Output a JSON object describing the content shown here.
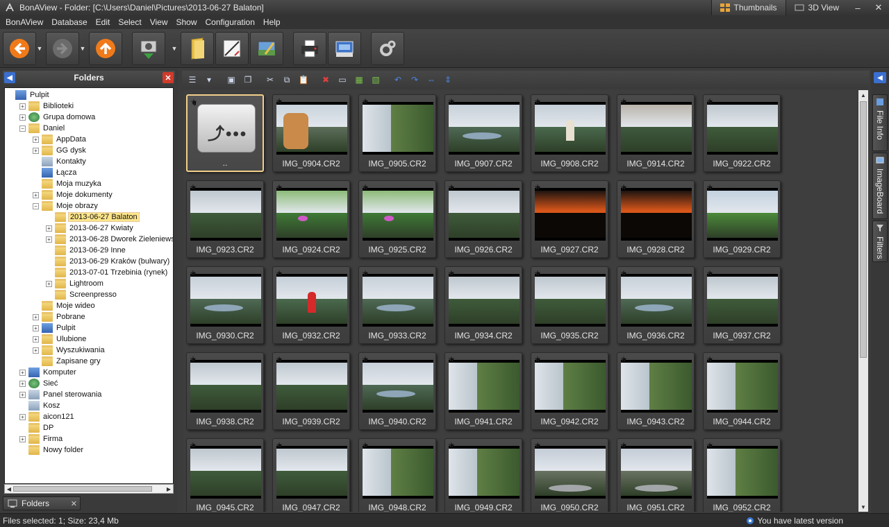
{
  "window": {
    "title": "BonAView - Folder: [C:\\Users\\Daniel\\Pictures\\2013-06-27 Balaton]",
    "view_tabs": [
      "Thumbnails",
      "3D View"
    ],
    "controls": {
      "minimize": "–",
      "close": "✕"
    }
  },
  "menu": [
    "BonAView",
    "Database",
    "Edit",
    "Select",
    "View",
    "Show",
    "Configuration",
    "Help"
  ],
  "toolbar": {
    "buttons": [
      "back-icon",
      "forward-icon",
      "up-icon",
      "import-icon",
      "folder-icon",
      "edit-icon",
      "slideshow-icon",
      "print-icon",
      "scanner-icon",
      "settings-icon"
    ],
    "colors": {
      "nav_orange": "#f07a1a",
      "folder_yellow": "#e9c04a"
    }
  },
  "left_panel": {
    "header": "Folders",
    "tab_label": "Folders",
    "tree": [
      {
        "label": "Pulpit",
        "level": 0,
        "icon": "desktop",
        "exp": ""
      },
      {
        "label": "Biblioteki",
        "level": 1,
        "icon": "folder",
        "exp": "+"
      },
      {
        "label": "Grupa domowa",
        "level": 1,
        "icon": "green",
        "exp": "+"
      },
      {
        "label": "Daniel",
        "level": 1,
        "icon": "folder",
        "exp": "-"
      },
      {
        "label": "AppData",
        "level": 2,
        "icon": "folder",
        "exp": "+"
      },
      {
        "label": "GG dysk",
        "level": 2,
        "icon": "folder",
        "exp": "+"
      },
      {
        "label": "Kontakty",
        "level": 2,
        "icon": "grey",
        "exp": ""
      },
      {
        "label": "Łącza",
        "level": 2,
        "icon": "blue",
        "exp": ""
      },
      {
        "label": "Moja muzyka",
        "level": 2,
        "icon": "folder",
        "exp": ""
      },
      {
        "label": "Moje dokumenty",
        "level": 2,
        "icon": "folder",
        "exp": "+"
      },
      {
        "label": "Moje obrazy",
        "level": 2,
        "icon": "folder",
        "exp": "-"
      },
      {
        "label": "2013-06-27 Balaton",
        "level": 3,
        "icon": "folder",
        "exp": "",
        "selected": true
      },
      {
        "label": "2013-06-27 Kwiaty",
        "level": 3,
        "icon": "folder",
        "exp": "+"
      },
      {
        "label": "2013-06-28 Dworek Zieleniewskich",
        "level": 3,
        "icon": "folder",
        "exp": "+"
      },
      {
        "label": "2013-06-29 Inne",
        "level": 3,
        "icon": "folder",
        "exp": ""
      },
      {
        "label": "2013-06-29 Kraków (bulwary)",
        "level": 3,
        "icon": "folder",
        "exp": ""
      },
      {
        "label": "2013-07-01 Trzebinia (rynek)",
        "level": 3,
        "icon": "folder",
        "exp": ""
      },
      {
        "label": "Lightroom",
        "level": 3,
        "icon": "folder",
        "exp": "+"
      },
      {
        "label": "Screenpresso",
        "level": 3,
        "icon": "folder",
        "exp": ""
      },
      {
        "label": "Moje wideo",
        "level": 2,
        "icon": "folder",
        "exp": ""
      },
      {
        "label": "Pobrane",
        "level": 2,
        "icon": "folder",
        "exp": "+"
      },
      {
        "label": "Pulpit",
        "level": 2,
        "icon": "blue",
        "exp": "+"
      },
      {
        "label": "Ulubione",
        "level": 2,
        "icon": "folder",
        "exp": "+"
      },
      {
        "label": "Wyszukiwania",
        "level": 2,
        "icon": "folder",
        "exp": "+"
      },
      {
        "label": "Zapisane gry",
        "level": 2,
        "icon": "folder",
        "exp": ""
      },
      {
        "label": "Komputer",
        "level": 1,
        "icon": "blue",
        "exp": "+"
      },
      {
        "label": "Sieć",
        "level": 1,
        "icon": "green",
        "exp": "+"
      },
      {
        "label": "Panel sterowania",
        "level": 1,
        "icon": "grey",
        "exp": "+"
      },
      {
        "label": "Kosz",
        "level": 1,
        "icon": "grey",
        "exp": ""
      },
      {
        "label": "aicon121",
        "level": 1,
        "icon": "folder",
        "exp": "+"
      },
      {
        "label": "DP",
        "level": 1,
        "icon": "folder",
        "exp": ""
      },
      {
        "label": "Firma",
        "level": 1,
        "icon": "folder",
        "exp": "+"
      },
      {
        "label": "Nowy folder",
        "level": 1,
        "icon": "folder",
        "exp": ""
      }
    ]
  },
  "panel_toolbar": [
    "list-view-icon",
    "dropdown-icon",
    "open-icon",
    "copy-to-folder-icon",
    "cut-icon",
    "copy-icon",
    "paste-icon",
    "delete-icon",
    "rename-icon",
    "select-all-icon",
    "invert-icon",
    "rotate-left-icon",
    "rotate-right-icon",
    "flip-horizontal-icon",
    "flip-vertical-icon"
  ],
  "thumbnails": {
    "rating": "0",
    "items": [
      {
        "name": "..",
        "folder": true
      },
      {
        "name": "IMG_0904.CR2",
        "scene": "dog"
      },
      {
        "name": "IMG_0905.CR2",
        "scene": "rotated"
      },
      {
        "name": "IMG_0907.CR2",
        "scene": "lake"
      },
      {
        "name": "IMG_0908.CR2",
        "scene": "person"
      },
      {
        "name": "IMG_0914.CR2",
        "scene": "rock"
      },
      {
        "name": "IMG_0922.CR2",
        "scene": "field"
      },
      {
        "name": "IMG_0923.CR2",
        "scene": "field"
      },
      {
        "name": "IMG_0924.CR2",
        "scene": "flowers"
      },
      {
        "name": "IMG_0925.CR2",
        "scene": "flowers"
      },
      {
        "name": "IMG_0926.CR2",
        "scene": "field"
      },
      {
        "name": "IMG_0927.CR2",
        "scene": "sunset"
      },
      {
        "name": "IMG_0928.CR2",
        "scene": "sunset"
      },
      {
        "name": "IMG_0929.CR2",
        "scene": "leaves"
      },
      {
        "name": "IMG_0930.CR2",
        "scene": "lake"
      },
      {
        "name": "IMG_0932.CR2",
        "scene": "person"
      },
      {
        "name": "IMG_0933.CR2",
        "scene": "lake"
      },
      {
        "name": "IMG_0934.CR2",
        "scene": "field"
      },
      {
        "name": "IMG_0935.CR2",
        "scene": "field"
      },
      {
        "name": "IMG_0936.CR2",
        "scene": "lake"
      },
      {
        "name": "IMG_0937.CR2",
        "scene": "field"
      },
      {
        "name": "IMG_0938.CR2",
        "scene": "field"
      },
      {
        "name": "IMG_0939.CR2",
        "scene": "field"
      },
      {
        "name": "IMG_0940.CR2",
        "scene": "lake"
      },
      {
        "name": "IMG_0941.CR2",
        "scene": "rotated"
      },
      {
        "name": "IMG_0942.CR2",
        "scene": "rotated"
      },
      {
        "name": "IMG_0943.CR2",
        "scene": "rotated"
      },
      {
        "name": "IMG_0944.CR2",
        "scene": "rotated"
      },
      {
        "name": "IMG_0945.CR2",
        "scene": "field"
      },
      {
        "name": "IMG_0947.CR2",
        "scene": "field"
      },
      {
        "name": "IMG_0948.CR2",
        "scene": "rotated"
      },
      {
        "name": "IMG_0949.CR2",
        "scene": "rotated"
      },
      {
        "name": "IMG_0950.CR2",
        "scene": "road"
      },
      {
        "name": "IMG_0951.CR2",
        "scene": "road"
      },
      {
        "name": "IMG_0952.CR2",
        "scene": "rotated"
      }
    ]
  },
  "right_tabs": [
    "File Info",
    "ImageBoard",
    "Filters"
  ],
  "status": {
    "left": "Files selected: 1; Size: 23,4 Mb",
    "right": "You have latest version"
  }
}
